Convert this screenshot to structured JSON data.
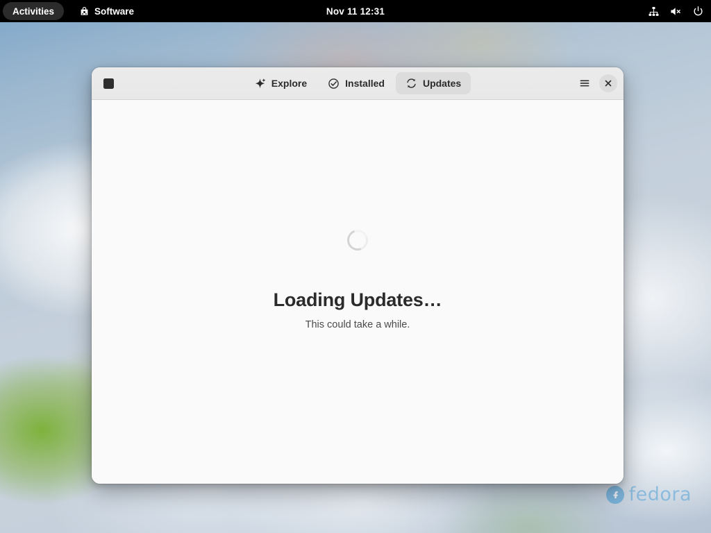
{
  "topbar": {
    "activities_label": "Activities",
    "app_name": "Software",
    "app_icon": "software-bag-icon",
    "clock": "Nov 11  12:31",
    "tray": [
      {
        "name": "wired-network-icon",
        "label": "Wired Network"
      },
      {
        "name": "volume-muted-icon",
        "label": "Volume Muted"
      },
      {
        "name": "power-icon",
        "label": "Power / System"
      }
    ]
  },
  "window": {
    "title": "Software",
    "headerbar": {
      "search_icon": "search-icon",
      "menu_icon": "hamburger-menu-icon",
      "close_icon": "close-icon"
    },
    "tabs": [
      {
        "id": "explore",
        "label": "Explore",
        "icon": "sparkle-icon",
        "active": false
      },
      {
        "id": "installed",
        "label": "Installed",
        "icon": "check-circle-icon",
        "active": false
      },
      {
        "id": "updates",
        "label": "Updates",
        "icon": "refresh-icon",
        "active": true
      }
    ],
    "content": {
      "spinner": "loading-spinner",
      "title": "Loading Updates…",
      "subtitle": "This could take a while."
    }
  },
  "desktop": {
    "watermark": {
      "brand": "fedora",
      "mark": "fedora-infinity-icon"
    }
  },
  "colors": {
    "topbar_bg": "#000000",
    "headerbar_bg": "#eaeaea",
    "content_bg": "#fafafa",
    "active_tab_bg": "#dcdcdc",
    "text_primary": "#2b2b2b",
    "text_secondary": "#4a4a4a",
    "fedora_blue": "#4d9fd6",
    "spinner_gray": "#d3d3d3"
  }
}
